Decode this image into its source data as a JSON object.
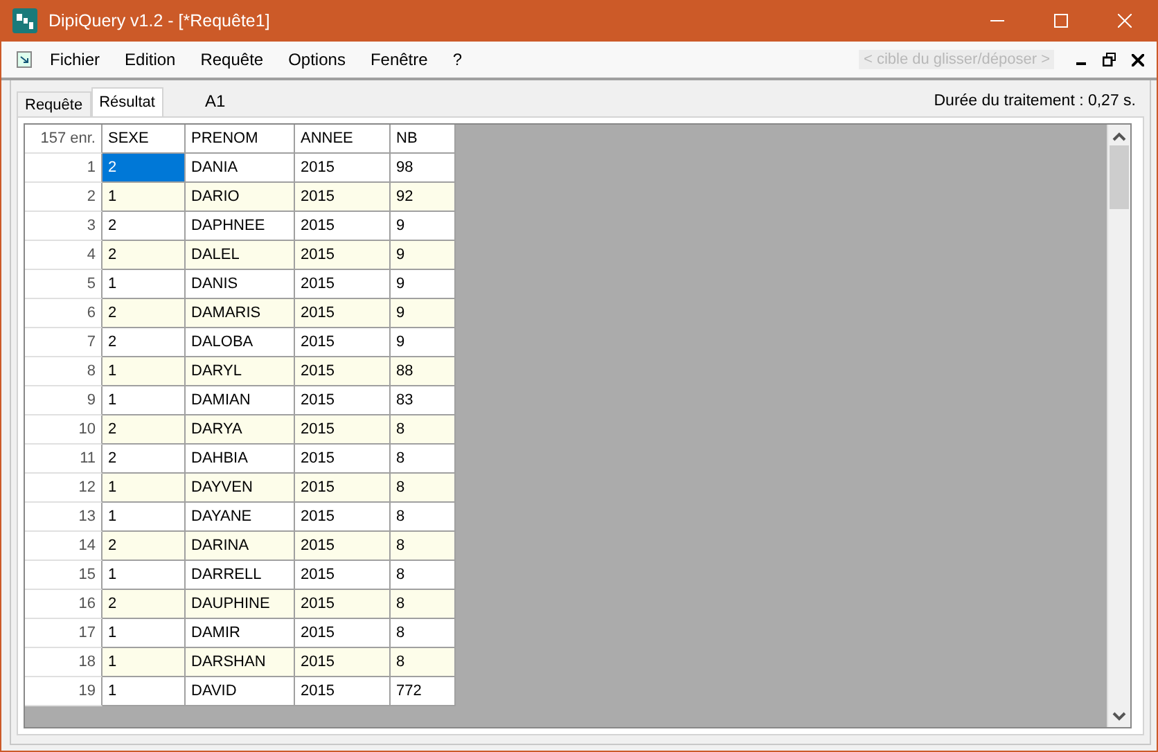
{
  "window": {
    "title": "DipiQuery v1.2 - [*Requête1]"
  },
  "menu": [
    {
      "label": "Fichier"
    },
    {
      "label": "Edition"
    },
    {
      "label": "Requête"
    },
    {
      "label": "Options"
    },
    {
      "label": "Fenêtre"
    },
    {
      "label": "?"
    }
  ],
  "drop_target": "< cible du glisser/déposer >",
  "tabs": [
    {
      "label": "Requête",
      "selected": false
    },
    {
      "label": "Résultat",
      "selected": true
    }
  ],
  "cell_ref": "A1",
  "duration": "Durée du traitement : 0,27 s.",
  "table": {
    "count": "157 enr.",
    "columns": [
      "SEXE",
      "PRENOM",
      "ANNEE",
      "NB"
    ],
    "rows": [
      {
        "n": "1",
        "cells": [
          "2",
          "DANIA",
          "2015",
          "98"
        ],
        "selected": true
      },
      {
        "n": "2",
        "cells": [
          "1",
          "DARIO",
          "2015",
          "92"
        ],
        "selected": false
      },
      {
        "n": "3",
        "cells": [
          "2",
          "DAPHNEE",
          "2015",
          "9"
        ],
        "selected": false
      },
      {
        "n": "4",
        "cells": [
          "2",
          "DALEL",
          "2015",
          "9"
        ],
        "selected": false
      },
      {
        "n": "5",
        "cells": [
          "1",
          "DANIS",
          "2015",
          "9"
        ],
        "selected": false
      },
      {
        "n": "6",
        "cells": [
          "2",
          "DAMARIS",
          "2015",
          "9"
        ],
        "selected": false
      },
      {
        "n": "7",
        "cells": [
          "2",
          "DALOBA",
          "2015",
          "9"
        ],
        "selected": false
      },
      {
        "n": "8",
        "cells": [
          "1",
          "DARYL",
          "2015",
          "88"
        ],
        "selected": false
      },
      {
        "n": "9",
        "cells": [
          "1",
          "DAMIAN",
          "2015",
          "83"
        ],
        "selected": false
      },
      {
        "n": "10",
        "cells": [
          "2",
          "DARYA",
          "2015",
          "8"
        ],
        "selected": false
      },
      {
        "n": "11",
        "cells": [
          "2",
          "DAHBIA",
          "2015",
          "8"
        ],
        "selected": false
      },
      {
        "n": "12",
        "cells": [
          "1",
          "DAYVEN",
          "2015",
          "8"
        ],
        "selected": false
      },
      {
        "n": "13",
        "cells": [
          "1",
          "DAYANE",
          "2015",
          "8"
        ],
        "selected": false
      },
      {
        "n": "14",
        "cells": [
          "2",
          "DARINA",
          "2015",
          "8"
        ],
        "selected": false
      },
      {
        "n": "15",
        "cells": [
          "1",
          "DARRELL",
          "2015",
          "8"
        ],
        "selected": false
      },
      {
        "n": "16",
        "cells": [
          "2",
          "DAUPHINE",
          "2015",
          "8"
        ],
        "selected": false
      },
      {
        "n": "17",
        "cells": [
          "1",
          "DAMIR",
          "2015",
          "8"
        ],
        "selected": false
      },
      {
        "n": "18",
        "cells": [
          "1",
          "DARSHAN",
          "2015",
          "8"
        ],
        "selected": false
      },
      {
        "n": "19",
        "cells": [
          "1",
          "DAVID",
          "2015",
          "772"
        ],
        "selected": false
      }
    ]
  }
}
